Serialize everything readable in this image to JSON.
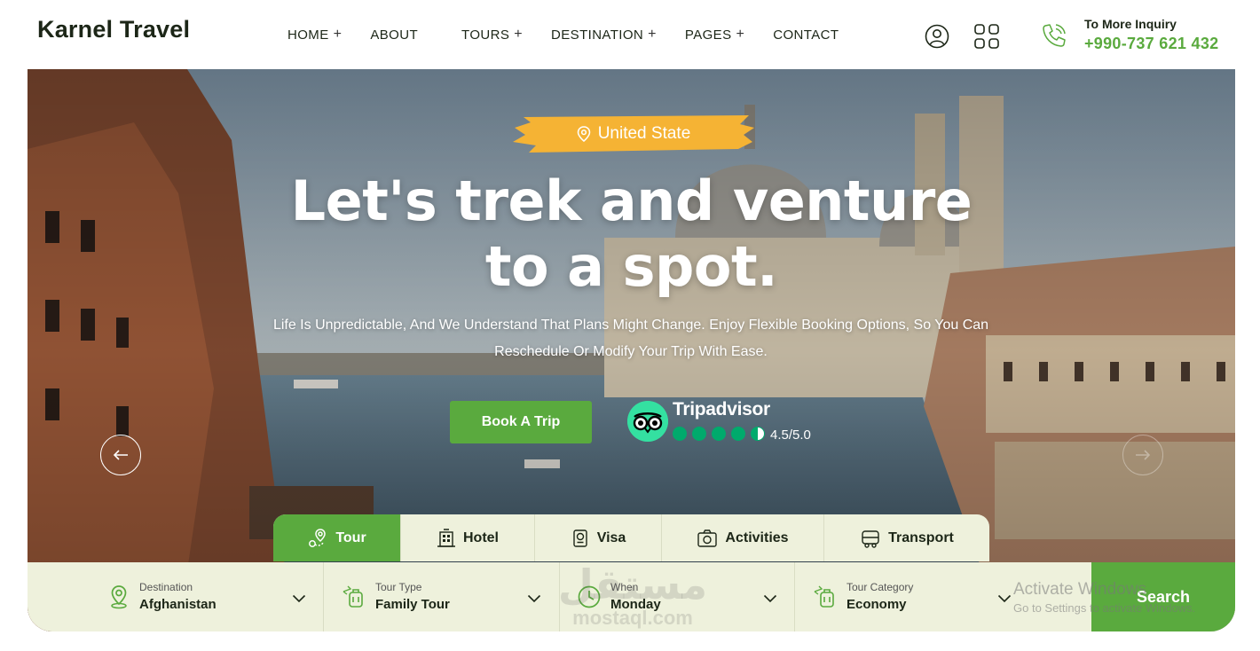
{
  "header": {
    "logo": "Karnel Travel",
    "nav": [
      {
        "label": "HOME",
        "plus": "+"
      },
      {
        "label": "ABOUT",
        "plus": ""
      },
      {
        "label": "TOURS",
        "plus": "+"
      },
      {
        "label": "DESTINATION",
        "plus": "+"
      },
      {
        "label": "PAGES",
        "plus": "+"
      },
      {
        "label": "CONTACT",
        "plus": ""
      }
    ],
    "icons": [
      "user-icon",
      "grid-icon"
    ],
    "inquiry_label": "To More Inquiry",
    "inquiry_phone": "+990-737 621 432"
  },
  "hero": {
    "badge": "United State",
    "headline_line1": "Let's trek and venture",
    "headline_line2": "to a spot.",
    "subtext_line1": "Life Is Unpredictable, And We Understand That Plans Might Change. Enjoy Flexible Booking Options, So You Can",
    "subtext_line2": "Reschedule Or Modify Your Trip With Ease.",
    "cta": "Book A Trip",
    "tripadvisor": {
      "name": "Tripadvisor",
      "rating": "4.5/5.0",
      "score": 4.5,
      "max": 5
    }
  },
  "tabs": [
    {
      "label": "Tour",
      "icon": "map-pin-icon",
      "active": true
    },
    {
      "label": "Hotel",
      "icon": "hotel-icon",
      "active": false
    },
    {
      "label": "Visa",
      "icon": "passport-icon",
      "active": false
    },
    {
      "label": "Activities",
      "icon": "camera-icon",
      "active": false
    },
    {
      "label": "Transport",
      "icon": "bus-icon",
      "active": false
    }
  ],
  "search": {
    "fields": [
      {
        "label": "Destination",
        "value": "Afghanistan",
        "icon": "location-icon"
      },
      {
        "label": "Tour Type",
        "value": "Family Tour",
        "icon": "luggage-plane-icon"
      },
      {
        "label": "When",
        "value": "Monday",
        "icon": "clock-icon"
      },
      {
        "label": "Tour Category",
        "value": "Economy",
        "icon": "luggage-plane-icon"
      }
    ],
    "button": "Search"
  },
  "overlays": {
    "watermark_ar": "مستقل",
    "watermark_en": "mostaql.com",
    "activate_title": "Activate Windows",
    "activate_sub": "Go to Settings to activate Windows."
  },
  "colors": {
    "accent": "#5aaa3e",
    "badge": "#f5b334",
    "panel": "#eef1dc",
    "tripadvisor": "#34e0a1"
  }
}
